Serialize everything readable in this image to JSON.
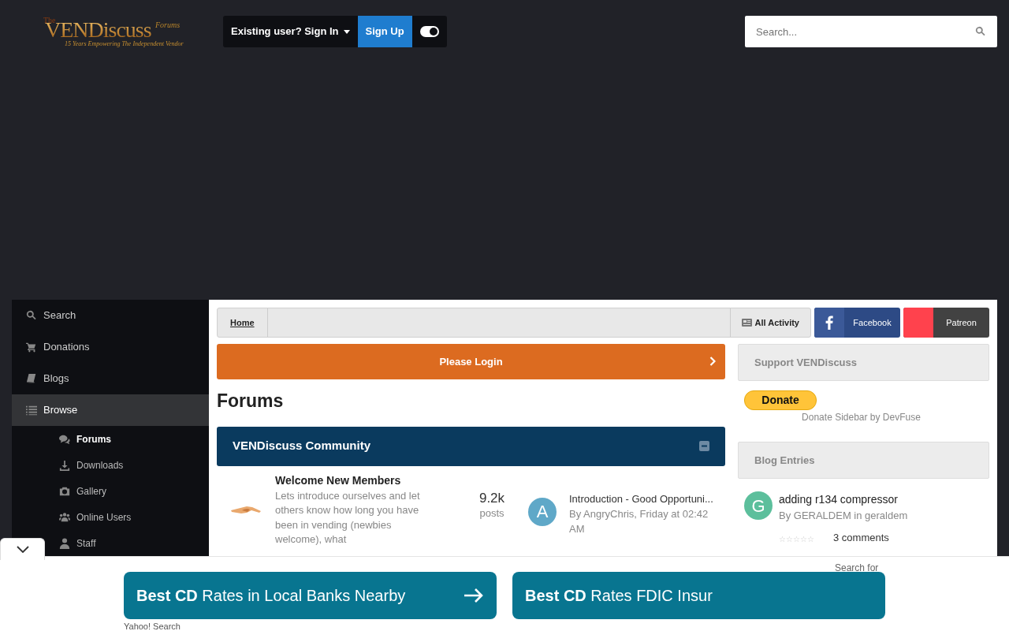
{
  "header": {
    "logo": {
      "small": "The",
      "main": "VENDiscuss",
      "forums": "Forums",
      "tagline": "15 Years Empowering The Independent Vendor"
    },
    "sign_in": "Existing user? Sign In",
    "sign_up": "Sign Up",
    "theme_toggle": {
      "on": true
    },
    "search": {
      "placeholder": "Search..."
    }
  },
  "sidebar": {
    "items": [
      {
        "label": "Search",
        "selected": false
      },
      {
        "label": "Donations",
        "selected": false
      },
      {
        "label": "Blogs",
        "selected": false
      },
      {
        "label": "Browse",
        "selected": true,
        "children": [
          {
            "label": "Forums",
            "selected": true
          },
          {
            "label": "Downloads",
            "selected": false
          },
          {
            "label": "Gallery",
            "selected": false
          },
          {
            "label": "Online Users",
            "selected": false
          },
          {
            "label": "Staff",
            "selected": false
          }
        ]
      }
    ]
  },
  "breadcrumb": {
    "items": [
      "Home"
    ],
    "all_activity": "All Activity"
  },
  "social": [
    {
      "label": "Facebook",
      "color": "#3b5998"
    },
    {
      "label": "Patreon",
      "color": "#ff424d"
    }
  ],
  "login_banner": "Please Login",
  "page_title": "Forums",
  "category": {
    "title": "VENDiscuss Community",
    "expanded": true
  },
  "forums": [
    {
      "title": "Welcome New Members",
      "description": "Lets introduce ourselves and let others know how long you have been in vending (newbies welcome), what",
      "count": "9.2k",
      "count_label": "posts",
      "last_post": {
        "avatar": "A",
        "color": "#5fa8c8",
        "title": "Introduction - Good Opportuni...",
        "meta": "By AngryChris, Friday at 02:42 AM"
      }
    }
  ],
  "support": {
    "title": "Support VENDiscuss",
    "donate": "Donate",
    "credit_text": "Donate Sidebar by",
    "credit_link": "DevFuse"
  },
  "blog": {
    "title": "Blog Entries",
    "entries": [
      {
        "avatar": "G",
        "color": "#5cbf9c",
        "title": "adding r134 compressor",
        "meta": "By GERALDEM in geraldem",
        "stars": 0,
        "comments": "3 comments"
      }
    ]
  },
  "ad_bar": {
    "label": "Search for",
    "buttons": [
      "**Best CD** Rates in Local Banks Nearby",
      "**Best CD** Rates FDIC Insur"
    ],
    "source": "Yahoo! Search"
  }
}
